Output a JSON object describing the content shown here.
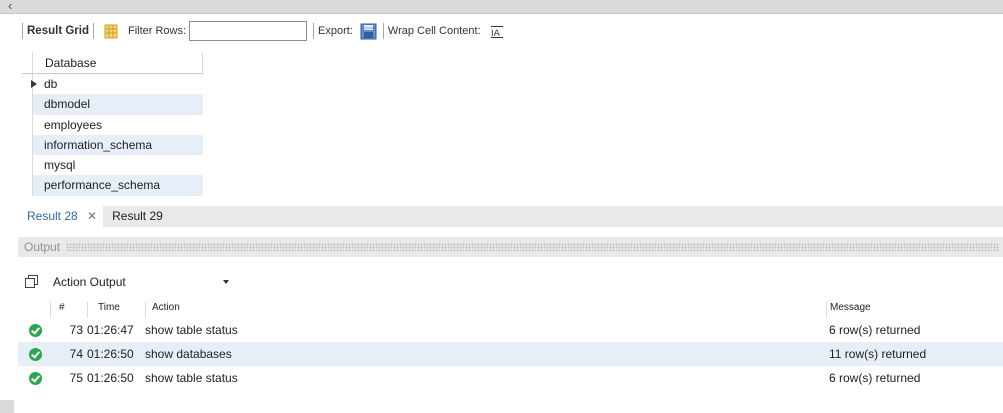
{
  "toolbar": {
    "result_grid_label": "Result Grid",
    "filter_rows_label": "Filter Rows:",
    "filter_rows_value": "",
    "export_label": "Export:",
    "wrap_label": "Wrap Cell Content:",
    "wrap_icon_text": "IA"
  },
  "grid": {
    "column": "Database",
    "rows": [
      "db",
      "dbmodel",
      "employees",
      "information_schema",
      "mysql",
      "performance_schema"
    ]
  },
  "result_tabs": [
    {
      "label": "Result 28",
      "closable": true,
      "active": true
    },
    {
      "label": "Result 29",
      "closable": false,
      "active": false
    }
  ],
  "output": {
    "title": "Output",
    "selector": "Action Output",
    "columns": {
      "num": "#",
      "time": "Time",
      "action": "Action",
      "message": "Message"
    },
    "rows": [
      {
        "num": "73",
        "time": "01:26:47",
        "action": "show table status",
        "message": "6 row(s) returned",
        "status": "ok"
      },
      {
        "num": "74",
        "time": "01:26:50",
        "action": "show databases",
        "message": "11 row(s) returned",
        "status": "ok"
      },
      {
        "num": "75",
        "time": "01:26:50",
        "action": "show table status",
        "message": "6 row(s) returned",
        "status": "ok"
      }
    ]
  },
  "colors": {
    "accent": "#2b6cb0",
    "row_alt": "#e6eef8",
    "ok": "#2da44e"
  }
}
